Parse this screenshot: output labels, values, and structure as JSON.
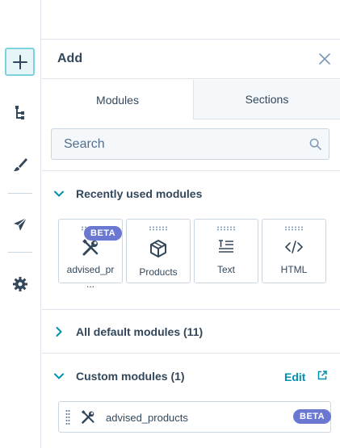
{
  "rail": {
    "items": [
      {
        "name": "add",
        "icon": "plus-icon",
        "active": true
      },
      {
        "name": "tree",
        "icon": "tree-icon"
      },
      {
        "name": "design",
        "icon": "brush-icon"
      },
      {
        "name": "publish",
        "icon": "send-icon"
      },
      {
        "name": "settings",
        "icon": "gear-icon"
      }
    ]
  },
  "panel": {
    "title": "Add",
    "tabs": [
      {
        "label": "Modules",
        "active": true
      },
      {
        "label": "Sections",
        "active": false
      }
    ],
    "search": {
      "placeholder": "Search",
      "value": ""
    }
  },
  "recent": {
    "label": "Recently used modules",
    "expanded": true,
    "tiles": [
      {
        "label": "advised_pr",
        "overflow": "...",
        "icon": "wrench-screwdriver-icon",
        "badge": "BETA"
      },
      {
        "label": "Products",
        "icon": "cube-icon"
      },
      {
        "label": "Text",
        "icon": "text-align-icon"
      },
      {
        "label": "HTML",
        "icon": "code-icon"
      }
    ]
  },
  "all_default": {
    "label": "All default modules (11)",
    "expanded": false
  },
  "custom": {
    "label": "Custom modules (1)",
    "expanded": true,
    "edit_label": "Edit",
    "items": [
      {
        "label": "advised_products",
        "badge": "BETA",
        "icon": "wrench-screwdriver-icon"
      }
    ]
  },
  "colors": {
    "accent": "#0091ae",
    "badge": "#6a78d1",
    "border": "#cbd6e2",
    "text": "#33475b"
  }
}
